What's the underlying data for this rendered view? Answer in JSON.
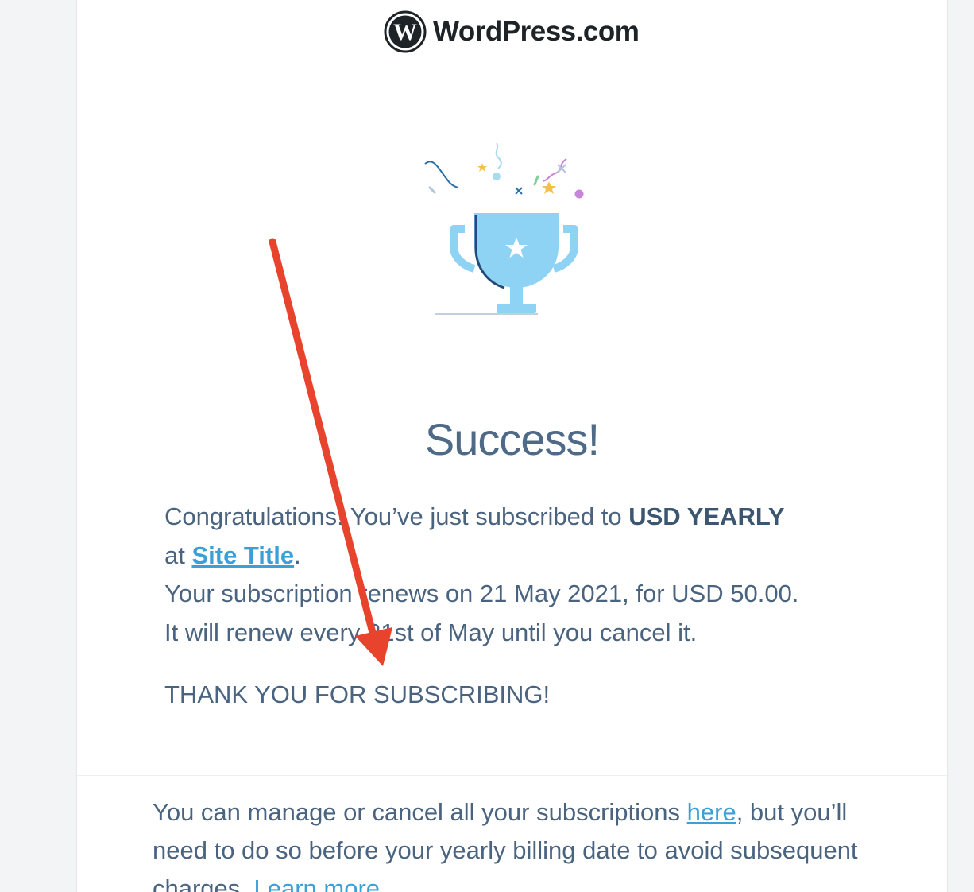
{
  "header": {
    "logo_text": "WordPress.com",
    "logo_icon": "wordpress-logo-icon"
  },
  "illustration": {
    "icon": "trophy-confetti-icon"
  },
  "main": {
    "heading": "Success!",
    "congrats_prefix": "Congratulations! You’ve just subscribed to ",
    "plan_name": "USD YEARLY",
    "at_text": "at ",
    "site_link": "Site Title",
    "period": ".",
    "renew_line": "Your subscription renews on 21 May 2021, for USD 50.00.",
    "renew_every_line": "It will renew every 21st of May until you cancel it.",
    "thanks": "THANK YOU FOR SUBSCRIBING!"
  },
  "footer": {
    "text_1": "You can manage or cancel all your subscriptions ",
    "here_link": "here",
    "text_2": ", but you’ll need to do so before your yearly billing date to avoid subsequent charges. ",
    "learn_more_link": "Learn more"
  },
  "annotation": {
    "arrow_color": "#e8432c"
  },
  "colors": {
    "text": "#4a6480",
    "link": "#3aa0d6",
    "trophy": "#8fd3f4"
  }
}
